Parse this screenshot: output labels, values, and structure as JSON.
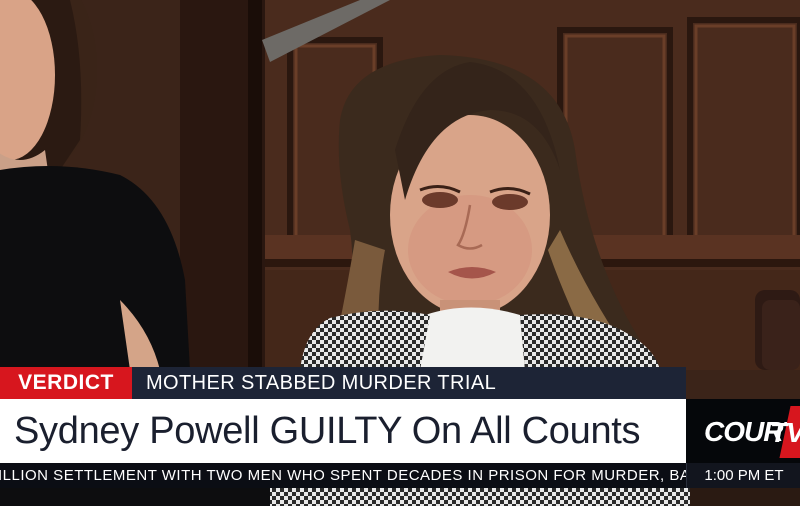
{
  "lower_third": {
    "tag": "VERDICT",
    "topic": "MOTHER STABBED MURDER TRIAL",
    "headline": "Sydney Powell GUILTY On All Counts"
  },
  "logo": {
    "text_main": "COURT",
    "text_tv": "TV"
  },
  "ticker": {
    "text": "ILLION SETTLEMENT WITH TWO MEN WHO SPENT DECADES IN PRISON FOR MURDER, BASED",
    "time": "1:00 PM ET"
  },
  "colors": {
    "tag_red": "#d7161e",
    "topic_navy": "#1d2436",
    "headline_bg": "#ffffff",
    "ticker_bg": "#0b0d14"
  }
}
